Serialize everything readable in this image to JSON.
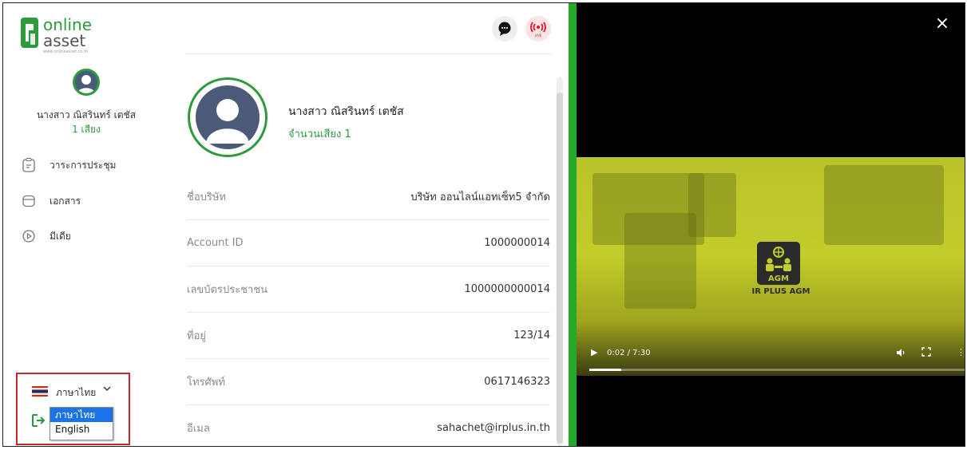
{
  "sidebar": {
    "logo": {
      "line1": "online",
      "line2": "asset",
      "tagline": "www.onlineasset.co.th"
    },
    "user_name": "นางสาว ณิสรินทร์ เตชัส",
    "user_votes": "1 เสียง",
    "nav": [
      {
        "label": "วาระการประชุม",
        "icon": "agenda-icon"
      },
      {
        "label": "เอกสาร",
        "icon": "folder-icon"
      },
      {
        "label": "มีเดีย",
        "icon": "play-circle-icon"
      }
    ],
    "language": {
      "current": "ภาษาไทย",
      "options": [
        "ภาษาไทย",
        "English"
      ],
      "selected_index": 0
    }
  },
  "profile": {
    "name": "นางสาว ณิสรินทร์ เตชัส",
    "votes": "จำนวนเสียง 1",
    "rows": [
      {
        "label": "ชื่อบริษัท",
        "value": "บริษัท ออนไลน์แอทเซ็ท5 จำกัด"
      },
      {
        "label": "Account ID",
        "value": "1000000014"
      },
      {
        "label": "เลขบัตรประชาชน",
        "value": "1000000000014"
      },
      {
        "label": "ที่อยู่",
        "value": "123/14"
      },
      {
        "label": "โทรศัพท์",
        "value": "0617146323"
      },
      {
        "label": "อีเมล",
        "value": "sahachet@irplus.in.th"
      }
    ],
    "top_icons": [
      "chat-icon",
      "live-icon"
    ],
    "live_badge": "LIVE"
  },
  "video": {
    "time": "0:02 / 7:30",
    "progress": 0.0044,
    "logo_text": "AGM",
    "brand": "IR PLUS AGM",
    "close": "×"
  },
  "colors": {
    "accent": "#2e9a3e",
    "highlight": "#c9272b",
    "select": "#1a73e8"
  }
}
